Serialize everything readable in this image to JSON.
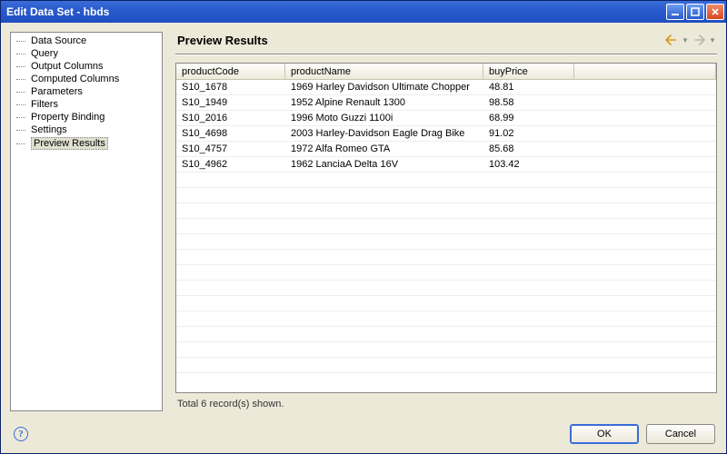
{
  "window": {
    "title": "Edit Data Set - hbds"
  },
  "sidebar": {
    "items": [
      {
        "label": "Data Source"
      },
      {
        "label": "Query"
      },
      {
        "label": "Output Columns"
      },
      {
        "label": "Computed Columns"
      },
      {
        "label": "Parameters"
      },
      {
        "label": "Filters"
      },
      {
        "label": "Property Binding"
      },
      {
        "label": "Settings"
      },
      {
        "label": "Preview Results"
      }
    ],
    "selected_index": 8
  },
  "content": {
    "title": "Preview Results",
    "columns": [
      "productCode",
      "productName",
      "buyPrice",
      ""
    ],
    "rows": [
      [
        "S10_1678",
        "1969 Harley Davidson Ultimate Chopper",
        "48.81",
        ""
      ],
      [
        "S10_1949",
        "1952 Alpine Renault 1300",
        "98.58",
        ""
      ],
      [
        "S10_2016",
        "1996 Moto Guzzi 1100i",
        "68.99",
        ""
      ],
      [
        "S10_4698",
        "2003 Harley-Davidson Eagle Drag Bike",
        "91.02",
        ""
      ],
      [
        "S10_4757",
        "1972 Alfa Romeo GTA",
        "85.68",
        ""
      ],
      [
        "S10_4962",
        "1962 LanciaA Delta 16V",
        "103.42",
        ""
      ]
    ],
    "status": "Total 6 record(s) shown."
  },
  "buttons": {
    "ok": "OK",
    "cancel": "Cancel"
  },
  "chart_data": {
    "type": "table",
    "title": "Preview Results",
    "columns": [
      "productCode",
      "productName",
      "buyPrice"
    ],
    "rows": [
      {
        "productCode": "S10_1678",
        "productName": "1969 Harley Davidson Ultimate Chopper",
        "buyPrice": 48.81
      },
      {
        "productCode": "S10_1949",
        "productName": "1952 Alpine Renault 1300",
        "buyPrice": 98.58
      },
      {
        "productCode": "S10_2016",
        "productName": "1996 Moto Guzzi 1100i",
        "buyPrice": 68.99
      },
      {
        "productCode": "S10_4698",
        "productName": "2003 Harley-Davidson Eagle Drag Bike",
        "buyPrice": 91.02
      },
      {
        "productCode": "S10_4757",
        "productName": "1972 Alfa Romeo GTA",
        "buyPrice": 85.68
      },
      {
        "productCode": "S10_4962",
        "productName": "1962 LanciaA Delta 16V",
        "buyPrice": 103.42
      }
    ]
  }
}
